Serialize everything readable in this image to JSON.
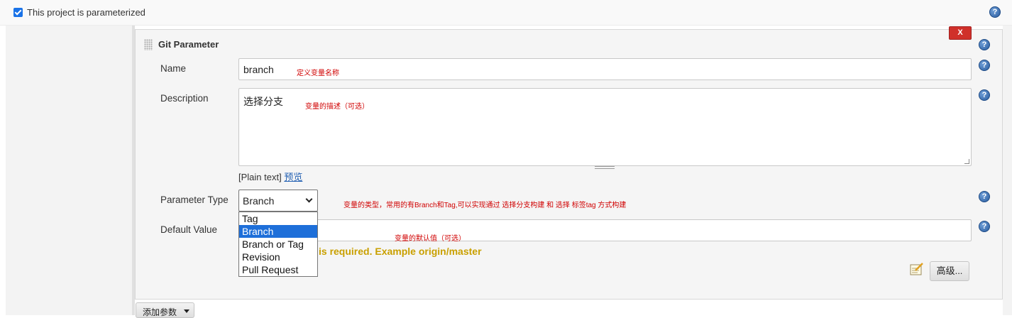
{
  "parameterized": {
    "label": "This project is parameterized",
    "checked": true
  },
  "section": {
    "title": "Git Parameter",
    "delete_label": "X"
  },
  "fields": {
    "name": {
      "label": "Name",
      "value": "branch",
      "note": "定义变量名称"
    },
    "description": {
      "label": "Description",
      "value": "选择分支",
      "note": "变量的描述（可选）",
      "plain_text": "[Plain text]",
      "preview": "预览"
    },
    "parameter_type": {
      "label": "Parameter Type",
      "value": "Branch",
      "note": "变量的类型，常用的有Branch和Tag,可以实现通过  选择分支构建  和  选择  标签tag  方式构建",
      "options": [
        "Tag",
        "Branch",
        "Branch or Tag",
        "Revision",
        "Pull Request"
      ],
      "selected_index": 1
    },
    "default_value": {
      "label": "Default Value",
      "value": "",
      "note": "变量的默认值（可选）",
      "warning": "is required. Example origin/master"
    }
  },
  "actions": {
    "advanced": "高级...",
    "add_parameter": "添加参数"
  },
  "help_glyph": "?",
  "icons": {
    "help": "help-icon",
    "notepad": "notepad-icon",
    "grip": "drag-handle-icon",
    "caret": "caret-down-icon"
  },
  "colors": {
    "checkbox": "#1a73e8",
    "delete_button": "#d0302a",
    "note_text": "#d00000",
    "warning_text": "#c9a000",
    "selected_option": "#1e6fd9",
    "link": "#2461b3"
  }
}
